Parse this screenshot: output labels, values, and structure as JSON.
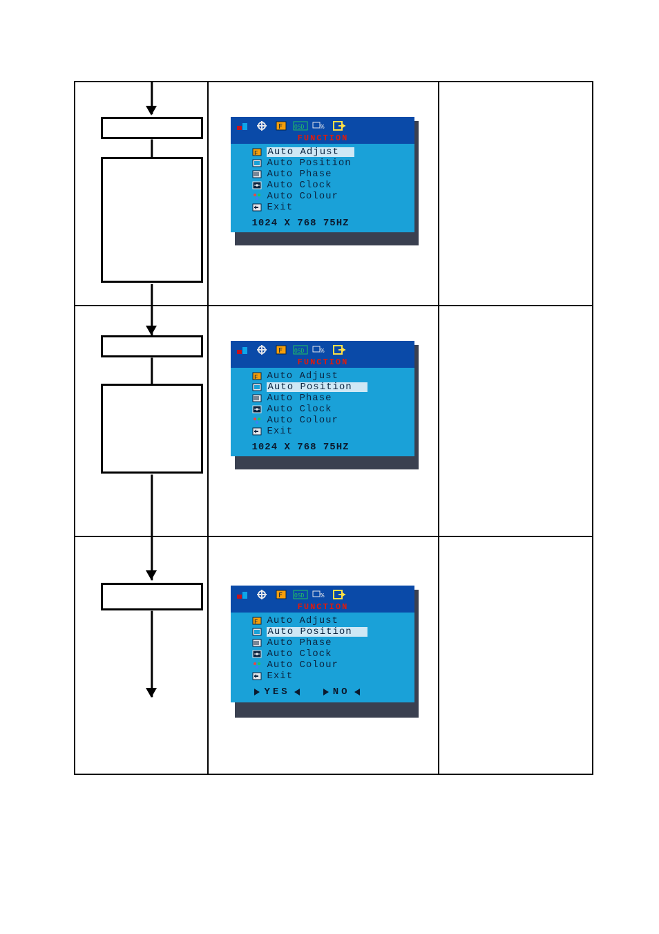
{
  "osd": {
    "title": "FUNCTION",
    "items": {
      "auto_adjust": "Auto Adjust",
      "auto_position": "Auto Position",
      "auto_phase": "Auto Phase",
      "auto_clock": "Auto Clock",
      "auto_colour": "Auto Colour",
      "exit": "Exit"
    },
    "status_line": "1024 X 768 75HZ",
    "yes_label": "YES",
    "no_label": "NO"
  },
  "rows": [
    {
      "selected": "auto_adjust",
      "footer": "status"
    },
    {
      "selected": "auto_position",
      "footer": "status"
    },
    {
      "selected": "auto_position",
      "footer": "yesno"
    }
  ]
}
